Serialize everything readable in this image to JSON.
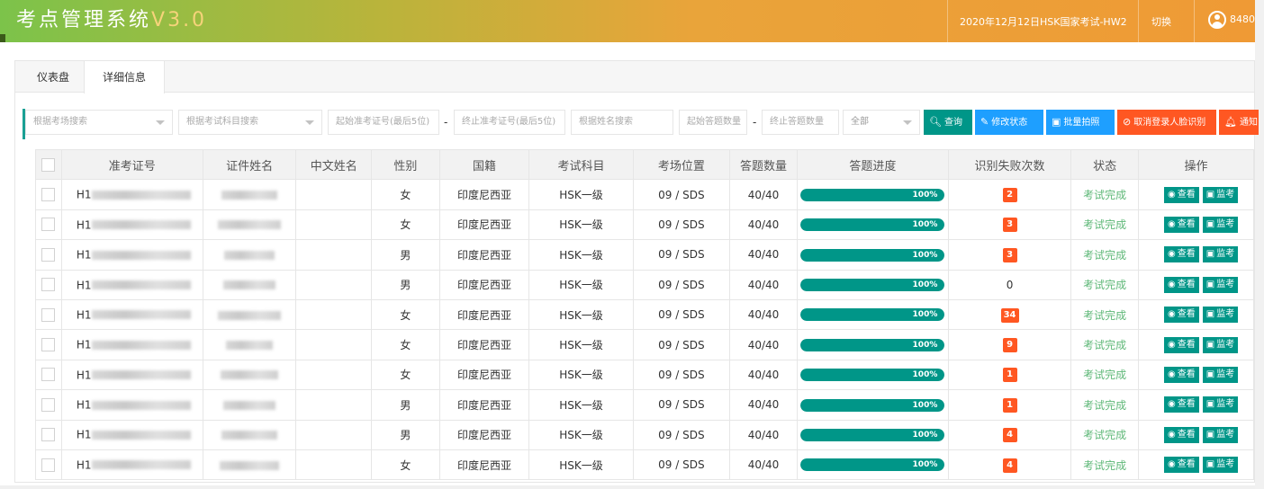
{
  "header": {
    "title": "考点管理系统",
    "version": "V3.0",
    "exam": "2020年12月12日HSK国家考试-HW2",
    "switch_label": "切换",
    "user": "8480"
  },
  "tabs": [
    {
      "label": "仪表盘"
    },
    {
      "label": "详细信息"
    }
  ],
  "filter": {
    "room_placeholder": "根据考场搜索",
    "subject_placeholder": "根据考试科目搜索",
    "start_ticket_placeholder": "起始准考证号(最后5位)",
    "end_ticket_placeholder": "终止准考证号(最后5位)",
    "name_placeholder": "根据姓名搜索",
    "start_count_placeholder": "起始答题数量",
    "end_count_placeholder": "终止答题数量",
    "status_select": "全部",
    "dash": "-",
    "buttons": {
      "search": "查询",
      "edit_status": "修改状态",
      "batch_photo": "批量拍照",
      "cancel_face": "取消登录人脸识别",
      "notify": "通知"
    }
  },
  "table": {
    "headers": [
      "准考证号",
      "证件姓名",
      "中文姓名",
      "性别",
      "国籍",
      "考试科目",
      "考场位置",
      "答题数量",
      "答题进度",
      "识别失败次数",
      "状态",
      "操作"
    ],
    "view_label": "查看",
    "monitor_label": "监考",
    "rows": [
      {
        "id_prefix": "H1",
        "gender": "女",
        "nationality": "印度尼西亚",
        "subject": "HSK一级",
        "location": "09 / SDS",
        "count": "40/40",
        "progress": 100,
        "progress_label": "100%",
        "fails": "2",
        "status": "考试完成"
      },
      {
        "id_prefix": "H1",
        "gender": "女",
        "nationality": "印度尼西亚",
        "subject": "HSK一级",
        "location": "09 / SDS",
        "count": "40/40",
        "progress": 100,
        "progress_label": "100%",
        "fails": "3",
        "status": "考试完成"
      },
      {
        "id_prefix": "H1",
        "gender": "男",
        "nationality": "印度尼西亚",
        "subject": "HSK一级",
        "location": "09 / SDS",
        "count": "40/40",
        "progress": 100,
        "progress_label": "100%",
        "fails": "3",
        "status": "考试完成"
      },
      {
        "id_prefix": "H1",
        "gender": "男",
        "nationality": "印度尼西亚",
        "subject": "HSK一级",
        "location": "09 / SDS",
        "count": "40/40",
        "progress": 100,
        "progress_label": "100%",
        "fails": "0",
        "status": "考试完成"
      },
      {
        "id_prefix": "H1",
        "gender": "女",
        "nationality": "印度尼西亚",
        "subject": "HSK一级",
        "location": "09 / SDS",
        "count": "40/40",
        "progress": 100,
        "progress_label": "100%",
        "fails": "34",
        "status": "考试完成"
      },
      {
        "id_prefix": "H1",
        "gender": "女",
        "nationality": "印度尼西亚",
        "subject": "HSK一级",
        "location": "09 / SDS",
        "count": "40/40",
        "progress": 100,
        "progress_label": "100%",
        "fails": "9",
        "status": "考试完成"
      },
      {
        "id_prefix": "H1",
        "gender": "女",
        "nationality": "印度尼西亚",
        "subject": "HSK一级",
        "location": "09 / SDS",
        "count": "40/40",
        "progress": 100,
        "progress_label": "100%",
        "fails": "1",
        "status": "考试完成"
      },
      {
        "id_prefix": "H1",
        "gender": "男",
        "nationality": "印度尼西亚",
        "subject": "HSK一级",
        "location": "09 / SDS",
        "count": "40/40",
        "progress": 100,
        "progress_label": "100%",
        "fails": "1",
        "status": "考试完成"
      },
      {
        "id_prefix": "H1",
        "gender": "男",
        "nationality": "印度尼西亚",
        "subject": "HSK一级",
        "location": "09 / SDS",
        "count": "40/40",
        "progress": 100,
        "progress_label": "100%",
        "fails": "4",
        "status": "考试完成"
      },
      {
        "id_prefix": "H1",
        "gender": "女",
        "nationality": "印度尼西亚",
        "subject": "HSK一级",
        "location": "09 / SDS",
        "count": "40/40",
        "progress": 100,
        "progress_label": "100%",
        "fails": "4",
        "status": "考试完成"
      }
    ]
  },
  "colors": {
    "accent": "#009688",
    "info": "#1e9fff",
    "danger": "#ff5722",
    "success": "#5fb878"
  }
}
